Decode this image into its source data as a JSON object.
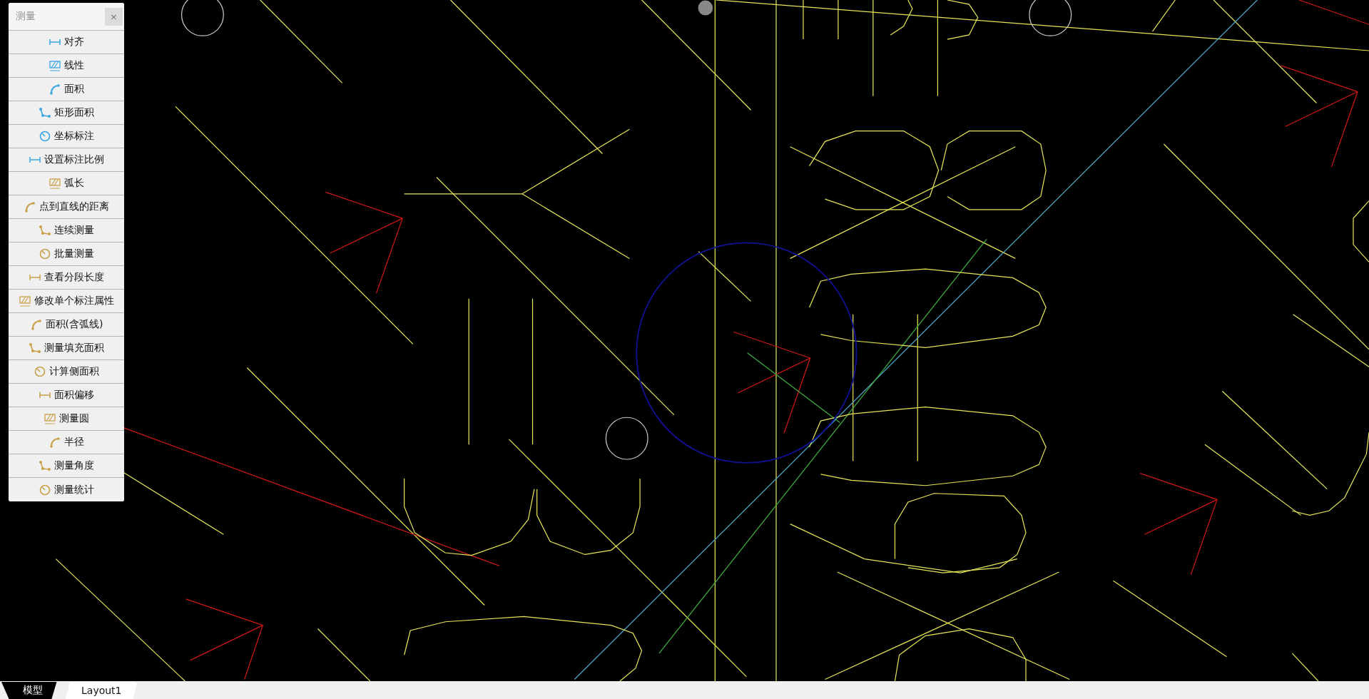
{
  "palette": {
    "title": "测量",
    "close": "×",
    "items": [
      {
        "label": "对齐"
      },
      {
        "label": "线性"
      },
      {
        "label": "面积"
      },
      {
        "label": "矩形面积"
      },
      {
        "label": "坐标标注"
      },
      {
        "label": "设置标注比例"
      },
      {
        "label": "弧长"
      },
      {
        "label": "点到直线的距离"
      },
      {
        "label": "连续测量"
      },
      {
        "label": "批量测量"
      },
      {
        "label": "查看分段长度"
      },
      {
        "label": "修改单个标注属性"
      },
      {
        "label": "面积(含弧线)"
      },
      {
        "label": "测量填充面积"
      },
      {
        "label": "计算侧面积"
      },
      {
        "label": "面积偏移"
      },
      {
        "label": "测量圆"
      },
      {
        "label": "半径"
      },
      {
        "label": "测量角度"
      },
      {
        "label": "测量统计"
      }
    ]
  },
  "layout_tabs": [
    {
      "label": "模型",
      "selected": true
    },
    {
      "label": "Layout1",
      "selected": false
    }
  ]
}
